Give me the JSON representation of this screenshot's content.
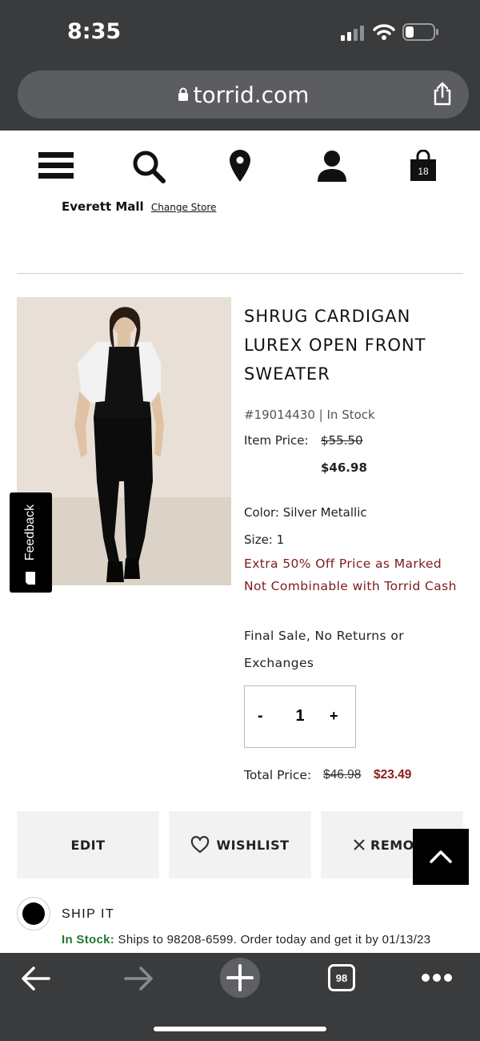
{
  "status_bar": {
    "time": "8:35",
    "icons": [
      "signal-icon",
      "wifi-icon",
      "battery-icon"
    ]
  },
  "browser": {
    "url": "torrid.com",
    "tab_count": "98"
  },
  "header": {
    "cart_count": "18",
    "store_name": "Everett Mall",
    "change_store": "Change Store"
  },
  "product": {
    "title": "SHRUG CARDIGAN LUREX OPEN FRONT SWEATER",
    "sku_status": "#19014430 | In Stock",
    "item_price_label": "Item Price:",
    "item_price_orig": "$55.50",
    "item_price_sale": "$46.98",
    "color": "Color: Silver Metallic",
    "size": "Size: 1",
    "promo": "Extra 50% Off Price as Marked Not Combinable with Torrid Cash",
    "final_sale": "Final Sale, No Returns or Exchanges",
    "qty_minus": "-",
    "qty_value": "1",
    "qty_plus": "+",
    "total_label": "Total Price:",
    "total_orig": "$46.98",
    "total_sale": "$23.49"
  },
  "actions": {
    "edit": "EDIT",
    "wishlist": "WISHLIST",
    "remove": "REMOVE"
  },
  "shipping": {
    "label": "SHIP IT",
    "instock": "In Stock:",
    "info": "Ships to 98208-6599. Order today and get it by 01/13/23"
  },
  "feedback": "Feedback"
}
